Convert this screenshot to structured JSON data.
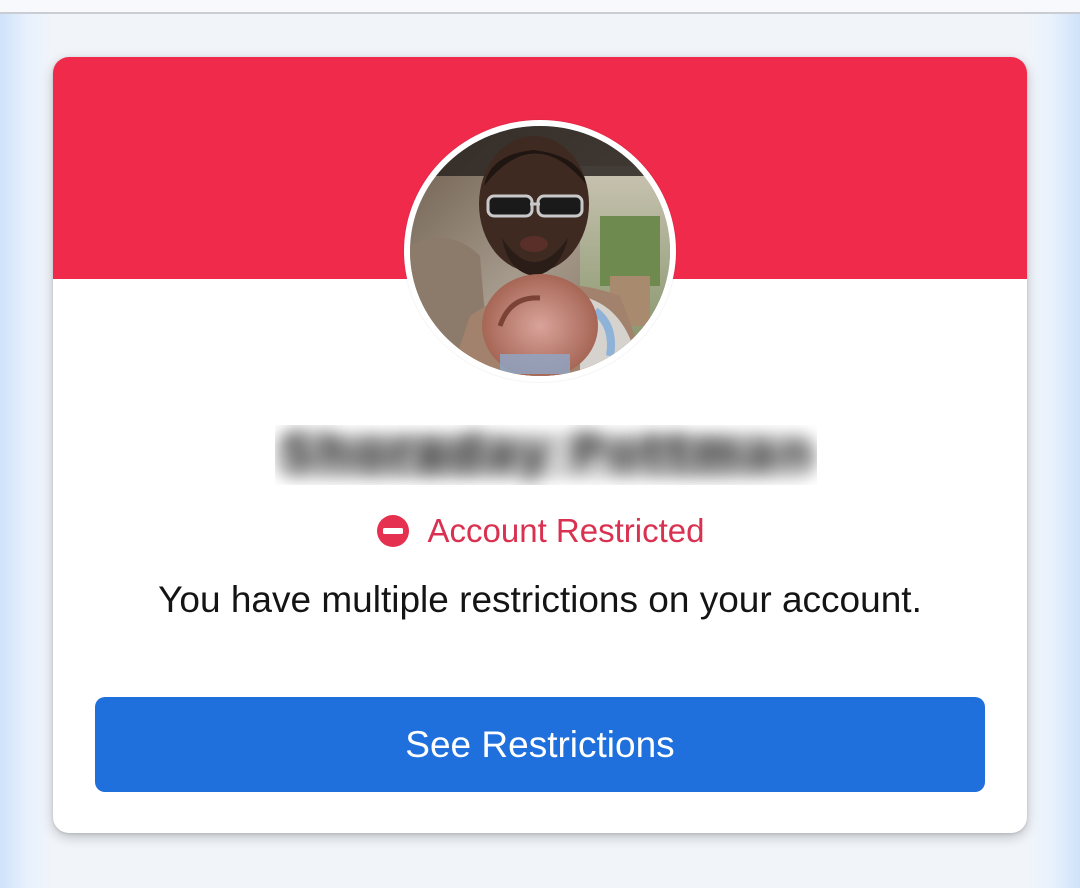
{
  "profile_card": {
    "avatar_icon": "profile-photo",
    "name": "Shoraday Pottman",
    "status": {
      "icon": "restricted-icon",
      "label": "Account Restricted"
    },
    "message": "You have multiple restrictions on your account.",
    "action_label": "See Restrictions"
  },
  "colors": {
    "banner": "#f02a4b",
    "status_text": "#d93150",
    "button": "#1f70dc",
    "button_text": "#ffffff"
  }
}
